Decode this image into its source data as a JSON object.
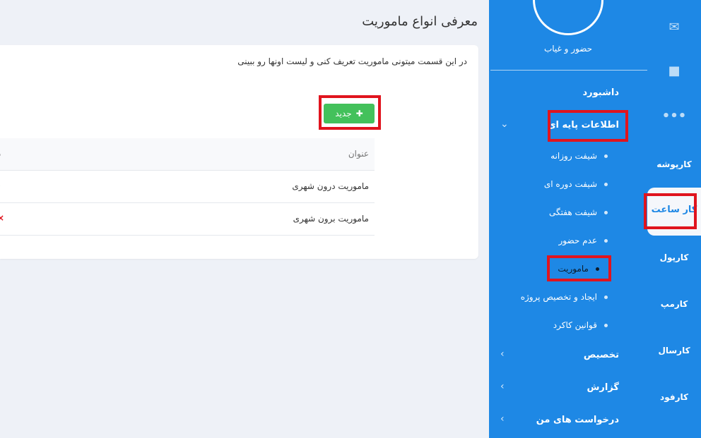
{
  "rail": {
    "items": [
      {
        "icon": "mail-icon",
        "label": ""
      },
      {
        "icon": "briefcase-icon",
        "label": ""
      },
      {
        "icon": "more-icon",
        "label": ""
      },
      {
        "label": "کارپوشه"
      },
      {
        "label": "کار ساعت",
        "active": true
      },
      {
        "label": "کارپول"
      },
      {
        "label": "کارمپ"
      },
      {
        "label": "کارسال"
      },
      {
        "label": "کارفود"
      }
    ]
  },
  "sidebar": {
    "brand_label": "حضور و غیاب",
    "dashboard": "داشبورد",
    "base_info": "اطلاعات پایه ای",
    "sub_items": [
      "شیفت روزانه",
      "شیفت دوره ای",
      "شیفت هفتگی",
      "عدم حضور",
      "ماموریت",
      "ایجاد و تخصیص پروژه",
      "قوانین کاکرد"
    ],
    "allocation": "تخصیص",
    "report": "گزارش",
    "my_requests": "درخواست های من"
  },
  "main": {
    "title": "معرفی انواع ماموریت",
    "description": "در این قسمت میتونی ماموریت تعریف کنی و لیست اونها رو ببینی",
    "new_button": "جدید",
    "table": {
      "header_title": "عنوان",
      "header_edge": "د",
      "rows": [
        {
          "title": "ماموریت درون شهری",
          "action": "›"
        },
        {
          "title": "ماموریت برون شهری",
          "action": "×"
        }
      ]
    }
  },
  "colors": {
    "sidebar_blue": "#1e88e5",
    "button_green": "#43c15b",
    "highlight_red": "#e0141e"
  }
}
